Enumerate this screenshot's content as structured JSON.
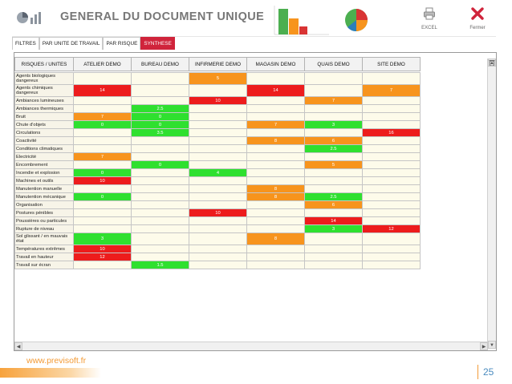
{
  "header": {
    "title": "GENERAL DU DOCUMENT UNIQUE",
    "excel_label": "EXCEL",
    "close_label": "Fermer"
  },
  "tabs": [
    {
      "label": "FILTRES",
      "active": false
    },
    {
      "label": "PAR UNITE DE TRAVAIL",
      "active": false
    },
    {
      "label": "PAR RISQUE",
      "active": false
    },
    {
      "label": "SYNTHESE",
      "active": true
    }
  ],
  "table": {
    "corner_label": "RISQUES / UNITES",
    "columns": [
      "ATELIER DEMO",
      "BUREAU DEMO",
      "INFIRMERIE DEMO",
      "MAGASIN DEMO",
      "QUAIS DEMO",
      "SITE DEMO"
    ],
    "rows": [
      {
        "label": "Agents biologiques dangereux",
        "tall": true,
        "cells": [
          null,
          null,
          {
            "v": "5",
            "c": "orange"
          },
          null,
          null,
          null
        ]
      },
      {
        "label": "Agents chimiques dangereux",
        "tall": true,
        "cells": [
          {
            "v": "14",
            "c": "red"
          },
          null,
          null,
          {
            "v": "14",
            "c": "red"
          },
          null,
          {
            "v": "7",
            "c": "orange"
          }
        ]
      },
      {
        "label": "Ambiances lumineuses",
        "cells": [
          null,
          null,
          {
            "v": "10",
            "c": "red"
          },
          null,
          {
            "v": "7",
            "c": "orange"
          },
          null
        ]
      },
      {
        "label": "Ambiances thermiques",
        "cells": [
          null,
          {
            "v": "2.5",
            "c": "green"
          },
          null,
          null,
          null,
          null
        ]
      },
      {
        "label": "Bruit",
        "cells": [
          {
            "v": "7",
            "c": "orange"
          },
          {
            "v": "0",
            "c": "green"
          },
          null,
          null,
          null,
          null
        ]
      },
      {
        "label": "Chute d'objets",
        "cells": [
          {
            "v": "0",
            "c": "green"
          },
          {
            "v": "0",
            "c": "green"
          },
          null,
          {
            "v": "7",
            "c": "orange"
          },
          {
            "v": "3",
            "c": "green"
          },
          null
        ]
      },
      {
        "label": "Circulations",
        "cells": [
          null,
          {
            "v": "3.5",
            "c": "green"
          },
          null,
          null,
          null,
          {
            "v": "16",
            "c": "red"
          }
        ]
      },
      {
        "label": "Coactivité",
        "cells": [
          null,
          null,
          null,
          {
            "v": "8",
            "c": "orange"
          },
          {
            "v": "6",
            "c": "orange"
          },
          null
        ]
      },
      {
        "label": "Conditions climatiques",
        "cells": [
          null,
          null,
          null,
          null,
          {
            "v": "2.5",
            "c": "green"
          },
          null
        ]
      },
      {
        "label": "Electricité",
        "cells": [
          {
            "v": "7",
            "c": "orange"
          },
          null,
          null,
          null,
          null,
          null
        ]
      },
      {
        "label": "Encombrement",
        "cells": [
          null,
          {
            "v": "0",
            "c": "green"
          },
          null,
          null,
          {
            "v": "5",
            "c": "orange"
          },
          null
        ]
      },
      {
        "label": "Incendie et explosion",
        "cells": [
          {
            "v": "0",
            "c": "green"
          },
          null,
          {
            "v": "4",
            "c": "green"
          },
          null,
          null,
          null
        ]
      },
      {
        "label": "Machines et outils",
        "cells": [
          {
            "v": "10",
            "c": "red"
          },
          null,
          null,
          null,
          null,
          null
        ]
      },
      {
        "label": "Manutention manuelle",
        "cells": [
          null,
          null,
          null,
          {
            "v": "8",
            "c": "orange"
          },
          null,
          null
        ]
      },
      {
        "label": "Manutention mécanique",
        "cells": [
          {
            "v": "0",
            "c": "green"
          },
          null,
          null,
          {
            "v": "8",
            "c": "orange"
          },
          {
            "v": "2.5",
            "c": "green"
          },
          null
        ]
      },
      {
        "label": "Organisation",
        "cells": [
          null,
          null,
          null,
          null,
          {
            "v": "6",
            "c": "orange"
          },
          null
        ]
      },
      {
        "label": "Postures pénibles",
        "cells": [
          null,
          null,
          {
            "v": "10",
            "c": "red"
          },
          null,
          null,
          null
        ]
      },
      {
        "label": "Poussières ou particules",
        "cells": [
          null,
          null,
          null,
          null,
          {
            "v": "14",
            "c": "red"
          },
          null
        ]
      },
      {
        "label": "Rupture de niveau",
        "cells": [
          null,
          null,
          null,
          null,
          {
            "v": "3",
            "c": "green"
          },
          {
            "v": "12",
            "c": "red"
          }
        ]
      },
      {
        "label": "Sol glissant / en mauvais état",
        "tall": true,
        "cells": [
          {
            "v": "3",
            "c": "green"
          },
          null,
          null,
          {
            "v": "8",
            "c": "orange"
          },
          null,
          null
        ]
      },
      {
        "label": "Températures extrêmes",
        "cells": [
          {
            "v": "10",
            "c": "red"
          },
          null,
          null,
          null,
          null,
          null
        ]
      },
      {
        "label": "Travail en hauteur",
        "cells": [
          {
            "v": "12",
            "c": "red"
          },
          null,
          null,
          null,
          null,
          null
        ]
      },
      {
        "label": "Travail sur écran",
        "cells": [
          null,
          {
            "v": "1.5",
            "c": "green"
          },
          null,
          null,
          null,
          null
        ]
      }
    ]
  },
  "footer": {
    "url": "www.previsoft.fr",
    "page_number": "25"
  },
  "colors": {
    "red": "#ed1c1c",
    "orange": "#f7941d",
    "green": "#2fe02f",
    "tab_active": "#d0243b"
  }
}
